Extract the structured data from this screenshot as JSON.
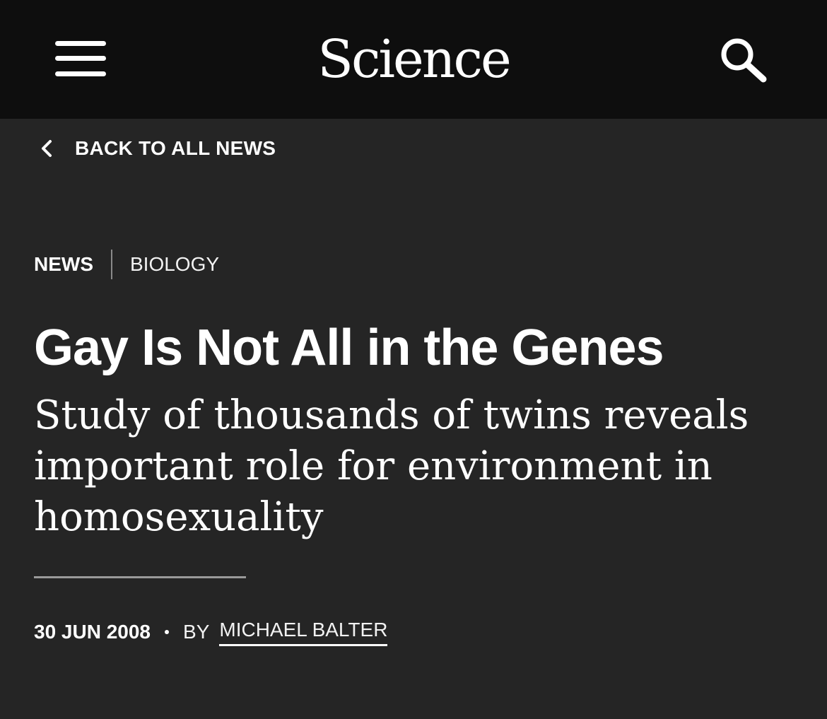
{
  "header": {
    "logo": "Science",
    "menu_icon": "hamburger-menu-icon",
    "search_icon": "search-icon"
  },
  "back_link": {
    "icon": "chevron-left-icon",
    "label": "BACK TO ALL NEWS"
  },
  "article": {
    "section": "NEWS",
    "category": "BIOLOGY",
    "title": "Gay Is Not All in the Genes",
    "subtitle": "Study of thousands of twins reveals important role for environment in homosexuality",
    "date": "30 JUN 2008",
    "by_label": "BY",
    "author": "MICHAEL BALTER"
  },
  "colors": {
    "header_background": "#0e0e0e",
    "page_background": "#252525",
    "text": "#ffffff",
    "divider": "#9a9a9a"
  }
}
